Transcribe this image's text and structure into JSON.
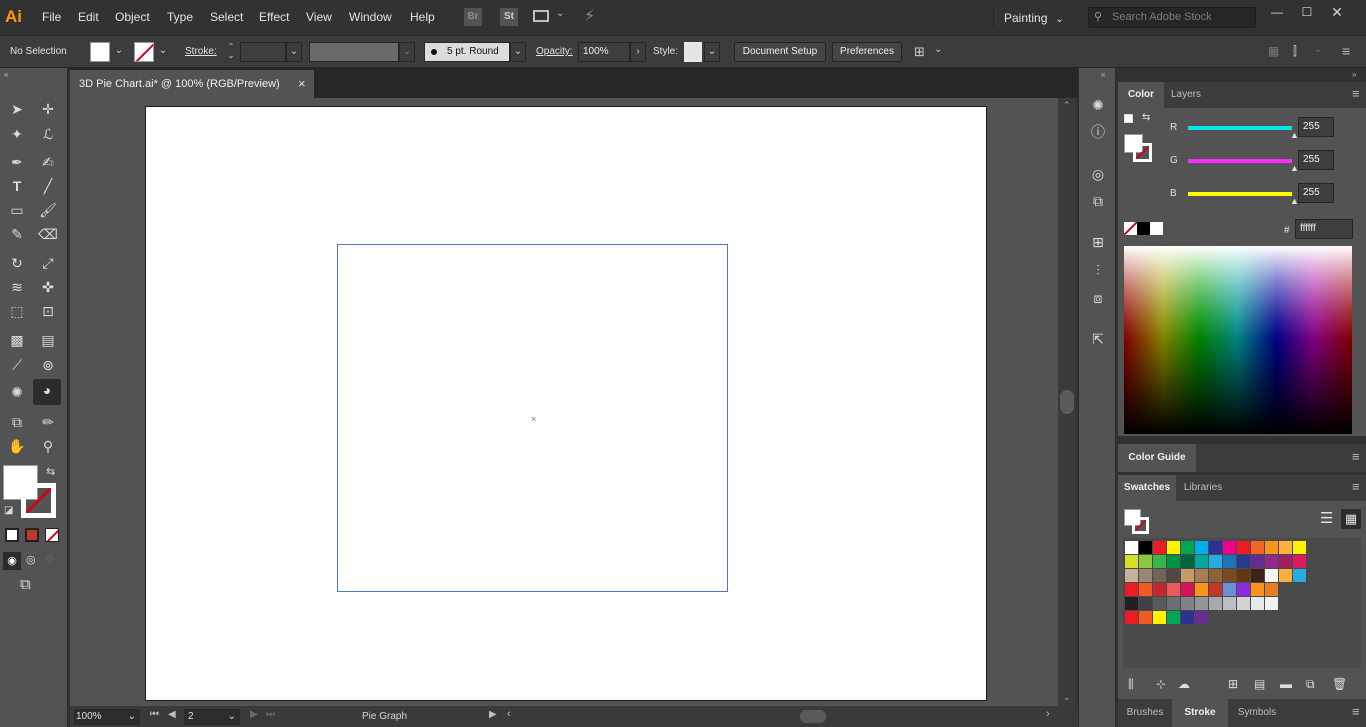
{
  "app": {
    "logo": "Ai"
  },
  "menu": [
    "File",
    "Edit",
    "Object",
    "Type",
    "Select",
    "Effect",
    "View",
    "Window",
    "Help"
  ],
  "menubar": {
    "bridge": "Br",
    "stock": "St",
    "workspace": "Painting",
    "search_placeholder": "Search Adobe Stock"
  },
  "control": {
    "selection": "No Selection",
    "stroke_label": "Stroke:",
    "brush": "5 pt. Round",
    "opacity_label": "Opacity:",
    "opacity_value": "100%",
    "style_label": "Style:",
    "doc_setup": "Document Setup",
    "preferences": "Preferences"
  },
  "document": {
    "tab_title": "3D Pie Chart.ai* @ 100% (RGB/Preview)",
    "close": "×",
    "center_mark": "×"
  },
  "status": {
    "zoom": "100%",
    "artboard_num": "2",
    "tool_name": "Pie Graph"
  },
  "color_panel": {
    "tabs": [
      "Color",
      "Layers"
    ],
    "r_label": "R",
    "g_label": "G",
    "b_label": "B",
    "r": "255",
    "g": "255",
    "b": "255",
    "hash": "#",
    "hex": "ffffff"
  },
  "color_guide": {
    "tab": "Color Guide"
  },
  "swatches_panel": {
    "tabs": [
      "Swatches",
      "Libraries"
    ]
  },
  "bottom_panel": {
    "tabs": [
      "Brushes",
      "Stroke",
      "Symbols"
    ]
  },
  "colors": {
    "accent_blue": "#4a78c2",
    "logo_orange": "#ff9a00",
    "r_slider": "#00e6e6",
    "g_slider": "#ff2bff",
    "b_slider": "#ffff00"
  },
  "swatch_rows": [
    [
      "#ffffff",
      "#000000",
      "#ed1c24",
      "#fff200",
      "#00a651",
      "#00aeef",
      "#2e3192",
      "#ec008c",
      "#ed1c24",
      "#f26522",
      "#f7941d",
      "#fbb040",
      "#fff200"
    ],
    [
      "#d7df23",
      "#8dc63f",
      "#39b54a",
      "#009444",
      "#006838",
      "#00a99d",
      "#27aae1",
      "#1c75bc",
      "#2b388f",
      "#662d91",
      "#92278f",
      "#9e1f63",
      "#da1c5c"
    ],
    [
      "#c7b299",
      "#998675",
      "#736357",
      "#534741",
      "#c69c6d",
      "#a67c52",
      "#8c6239",
      "#754c24",
      "#603913",
      "#3c2415",
      "#f5f5f5",
      "#fbb03b",
      "#29abe2"
    ],
    [
      "#ed1c24",
      "#f15a24",
      "#c1272d",
      "#e95b5b",
      "#d4145a",
      "#f7931e",
      "#c0392b",
      "#6d8fd6",
      "#8a2be2",
      "#f7931e",
      "#e67e22"
    ],
    [
      "#231f20",
      "#414042",
      "#58595b",
      "#6d6e71",
      "#808285",
      "#939598",
      "#a7a9ac",
      "#bcbec0",
      "#d1d3d4",
      "#e6e7e8",
      "#f1f2f2"
    ],
    [
      "#ed1c24",
      "#f15a24",
      "#fff200",
      "#00a651",
      "#2e3192",
      "#662d91"
    ]
  ]
}
